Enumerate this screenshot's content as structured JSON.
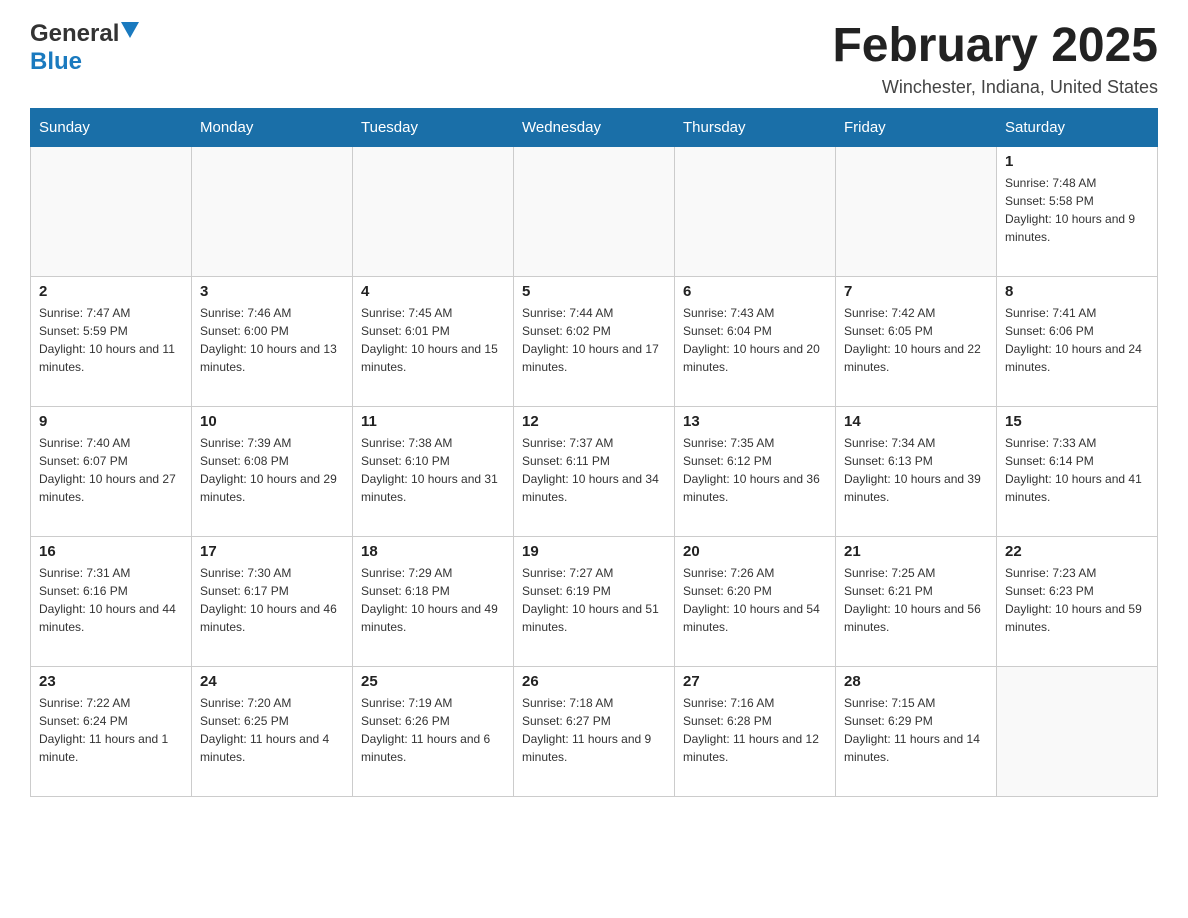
{
  "header": {
    "logo_general": "General",
    "logo_blue": "Blue",
    "title": "February 2025",
    "location": "Winchester, Indiana, United States"
  },
  "days_of_week": [
    "Sunday",
    "Monday",
    "Tuesday",
    "Wednesday",
    "Thursday",
    "Friday",
    "Saturday"
  ],
  "weeks": [
    [
      {
        "day": "",
        "info": ""
      },
      {
        "day": "",
        "info": ""
      },
      {
        "day": "",
        "info": ""
      },
      {
        "day": "",
        "info": ""
      },
      {
        "day": "",
        "info": ""
      },
      {
        "day": "",
        "info": ""
      },
      {
        "day": "1",
        "info": "Sunrise: 7:48 AM\nSunset: 5:58 PM\nDaylight: 10 hours and 9 minutes."
      }
    ],
    [
      {
        "day": "2",
        "info": "Sunrise: 7:47 AM\nSunset: 5:59 PM\nDaylight: 10 hours and 11 minutes."
      },
      {
        "day": "3",
        "info": "Sunrise: 7:46 AM\nSunset: 6:00 PM\nDaylight: 10 hours and 13 minutes."
      },
      {
        "day": "4",
        "info": "Sunrise: 7:45 AM\nSunset: 6:01 PM\nDaylight: 10 hours and 15 minutes."
      },
      {
        "day": "5",
        "info": "Sunrise: 7:44 AM\nSunset: 6:02 PM\nDaylight: 10 hours and 17 minutes."
      },
      {
        "day": "6",
        "info": "Sunrise: 7:43 AM\nSunset: 6:04 PM\nDaylight: 10 hours and 20 minutes."
      },
      {
        "day": "7",
        "info": "Sunrise: 7:42 AM\nSunset: 6:05 PM\nDaylight: 10 hours and 22 minutes."
      },
      {
        "day": "8",
        "info": "Sunrise: 7:41 AM\nSunset: 6:06 PM\nDaylight: 10 hours and 24 minutes."
      }
    ],
    [
      {
        "day": "9",
        "info": "Sunrise: 7:40 AM\nSunset: 6:07 PM\nDaylight: 10 hours and 27 minutes."
      },
      {
        "day": "10",
        "info": "Sunrise: 7:39 AM\nSunset: 6:08 PM\nDaylight: 10 hours and 29 minutes."
      },
      {
        "day": "11",
        "info": "Sunrise: 7:38 AM\nSunset: 6:10 PM\nDaylight: 10 hours and 31 minutes."
      },
      {
        "day": "12",
        "info": "Sunrise: 7:37 AM\nSunset: 6:11 PM\nDaylight: 10 hours and 34 minutes."
      },
      {
        "day": "13",
        "info": "Sunrise: 7:35 AM\nSunset: 6:12 PM\nDaylight: 10 hours and 36 minutes."
      },
      {
        "day": "14",
        "info": "Sunrise: 7:34 AM\nSunset: 6:13 PM\nDaylight: 10 hours and 39 minutes."
      },
      {
        "day": "15",
        "info": "Sunrise: 7:33 AM\nSunset: 6:14 PM\nDaylight: 10 hours and 41 minutes."
      }
    ],
    [
      {
        "day": "16",
        "info": "Sunrise: 7:31 AM\nSunset: 6:16 PM\nDaylight: 10 hours and 44 minutes."
      },
      {
        "day": "17",
        "info": "Sunrise: 7:30 AM\nSunset: 6:17 PM\nDaylight: 10 hours and 46 minutes."
      },
      {
        "day": "18",
        "info": "Sunrise: 7:29 AM\nSunset: 6:18 PM\nDaylight: 10 hours and 49 minutes."
      },
      {
        "day": "19",
        "info": "Sunrise: 7:27 AM\nSunset: 6:19 PM\nDaylight: 10 hours and 51 minutes."
      },
      {
        "day": "20",
        "info": "Sunrise: 7:26 AM\nSunset: 6:20 PM\nDaylight: 10 hours and 54 minutes."
      },
      {
        "day": "21",
        "info": "Sunrise: 7:25 AM\nSunset: 6:21 PM\nDaylight: 10 hours and 56 minutes."
      },
      {
        "day": "22",
        "info": "Sunrise: 7:23 AM\nSunset: 6:23 PM\nDaylight: 10 hours and 59 minutes."
      }
    ],
    [
      {
        "day": "23",
        "info": "Sunrise: 7:22 AM\nSunset: 6:24 PM\nDaylight: 11 hours and 1 minute."
      },
      {
        "day": "24",
        "info": "Sunrise: 7:20 AM\nSunset: 6:25 PM\nDaylight: 11 hours and 4 minutes."
      },
      {
        "day": "25",
        "info": "Sunrise: 7:19 AM\nSunset: 6:26 PM\nDaylight: 11 hours and 6 minutes."
      },
      {
        "day": "26",
        "info": "Sunrise: 7:18 AM\nSunset: 6:27 PM\nDaylight: 11 hours and 9 minutes."
      },
      {
        "day": "27",
        "info": "Sunrise: 7:16 AM\nSunset: 6:28 PM\nDaylight: 11 hours and 12 minutes."
      },
      {
        "day": "28",
        "info": "Sunrise: 7:15 AM\nSunset: 6:29 PM\nDaylight: 11 hours and 14 minutes."
      },
      {
        "day": "",
        "info": ""
      }
    ]
  ]
}
